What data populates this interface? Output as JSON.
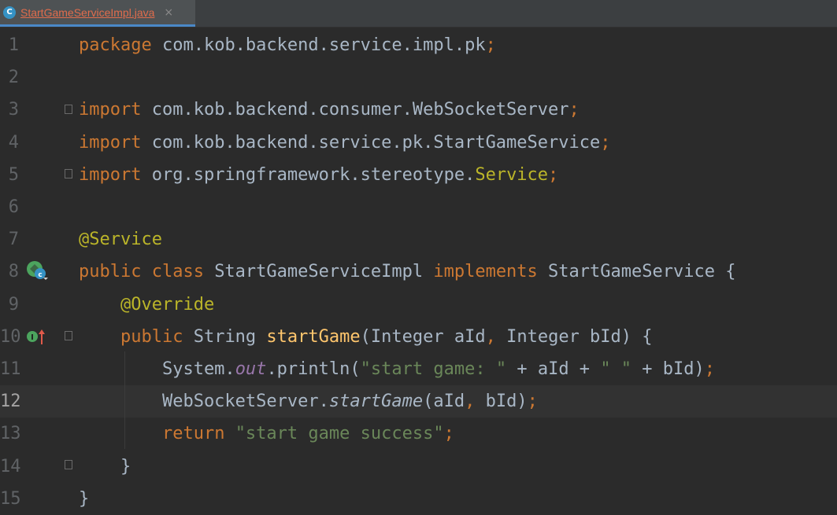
{
  "tab": {
    "title": "StartGameServiceImpl.java",
    "icon_letter": "C",
    "close": "×"
  },
  "lines": [
    {
      "n": "1",
      "tokens": [
        {
          "t": "package ",
          "c": "kw"
        },
        {
          "t": "com.kob.backend.service.impl.pk",
          "c": ""
        },
        {
          "t": ";",
          "c": "kw"
        }
      ]
    },
    {
      "n": "2",
      "tokens": []
    },
    {
      "n": "3",
      "tokens": [
        {
          "t": "import ",
          "c": "kw"
        },
        {
          "t": "com.kob.backend.consumer.WebSocketServer",
          "c": ""
        },
        {
          "t": ";",
          "c": "kw"
        }
      ]
    },
    {
      "n": "4",
      "tokens": [
        {
          "t": "import ",
          "c": "kw"
        },
        {
          "t": "com.kob.backend.service.pk.StartGameService",
          "c": ""
        },
        {
          "t": ";",
          "c": "kw"
        }
      ]
    },
    {
      "n": "5",
      "tokens": [
        {
          "t": "import ",
          "c": "kw"
        },
        {
          "t": "org.springframework.stereotype.",
          "c": ""
        },
        {
          "t": "Service",
          "c": "ann"
        },
        {
          "t": ";",
          "c": "kw"
        }
      ]
    },
    {
      "n": "6",
      "tokens": []
    },
    {
      "n": "7",
      "tokens": [
        {
          "t": "@Service",
          "c": "ann"
        }
      ]
    },
    {
      "n": "8",
      "tokens": [
        {
          "t": "public class ",
          "c": "kw"
        },
        {
          "t": "StartGameServiceImpl ",
          "c": ""
        },
        {
          "t": "implements ",
          "c": "kw"
        },
        {
          "t": "StartGameService {",
          "c": ""
        }
      ]
    },
    {
      "n": "9",
      "tokens": [
        {
          "t": "    ",
          "c": ""
        },
        {
          "t": "@Override",
          "c": "ann"
        }
      ]
    },
    {
      "n": "10",
      "tokens": [
        {
          "t": "    ",
          "c": ""
        },
        {
          "t": "public ",
          "c": "kw"
        },
        {
          "t": "String ",
          "c": ""
        },
        {
          "t": "startGame",
          "c": "fn"
        },
        {
          "t": "(Integer aId",
          "c": ""
        },
        {
          "t": ", ",
          "c": "kw"
        },
        {
          "t": "Integer bId) {",
          "c": ""
        }
      ]
    },
    {
      "n": "11",
      "tokens": [
        {
          "t": "        System.",
          "c": ""
        },
        {
          "t": "out",
          "c": "static"
        },
        {
          "t": ".println(",
          "c": ""
        },
        {
          "t": "\"start game: \"",
          "c": "str"
        },
        {
          "t": " + aId + ",
          "c": ""
        },
        {
          "t": "\" \"",
          "c": "str"
        },
        {
          "t": " + bId)",
          "c": ""
        },
        {
          "t": ";",
          "c": "kw"
        }
      ]
    },
    {
      "n": "12",
      "tokens": [
        {
          "t": "        WebSocketServer.",
          "c": ""
        },
        {
          "t": "startGame",
          "c": "it"
        },
        {
          "t": "(aId",
          "c": ""
        },
        {
          "t": ", ",
          "c": "kw"
        },
        {
          "t": "bId)",
          "c": ""
        },
        {
          "t": ";",
          "c": "kw"
        }
      ]
    },
    {
      "n": "13",
      "tokens": [
        {
          "t": "        ",
          "c": ""
        },
        {
          "t": "return ",
          "c": "kw"
        },
        {
          "t": "\"start game success\"",
          "c": "str"
        },
        {
          "t": ";",
          "c": "kw"
        }
      ]
    },
    {
      "n": "14",
      "tokens": [
        {
          "t": "    }",
          "c": ""
        }
      ]
    },
    {
      "n": "15",
      "tokens": [
        {
          "t": "}",
          "c": ""
        }
      ]
    }
  ],
  "current_line": "12",
  "colors": {
    "background": "#2b2b2b",
    "keyword": "#cc7832",
    "annotation": "#bbb529",
    "string": "#6a8759",
    "function": "#ffc66d",
    "static_field": "#9876aa",
    "default_text": "#a9b7c6"
  },
  "gutter_icons": {
    "line8": "implemented-class-icon",
    "line10": "implements-method-icon"
  }
}
